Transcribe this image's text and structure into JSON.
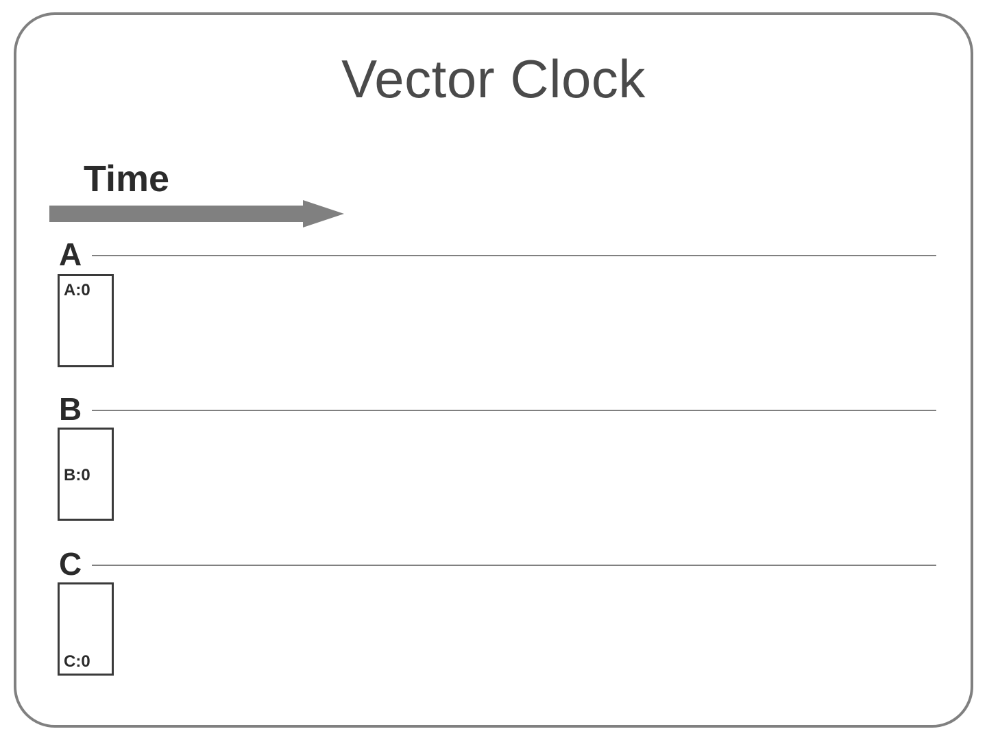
{
  "title": "Vector Clock",
  "timeLabel": "Time",
  "processes": {
    "a": {
      "label": "A",
      "clock": {
        "a": "A:0"
      }
    },
    "b": {
      "label": "B",
      "clock": {
        "b": "B:0"
      }
    },
    "c": {
      "label": "C",
      "clock": {
        "c": "C:0"
      }
    }
  },
  "arrow": {
    "shaftColor": "#808080",
    "shaftWidth": 24
  }
}
